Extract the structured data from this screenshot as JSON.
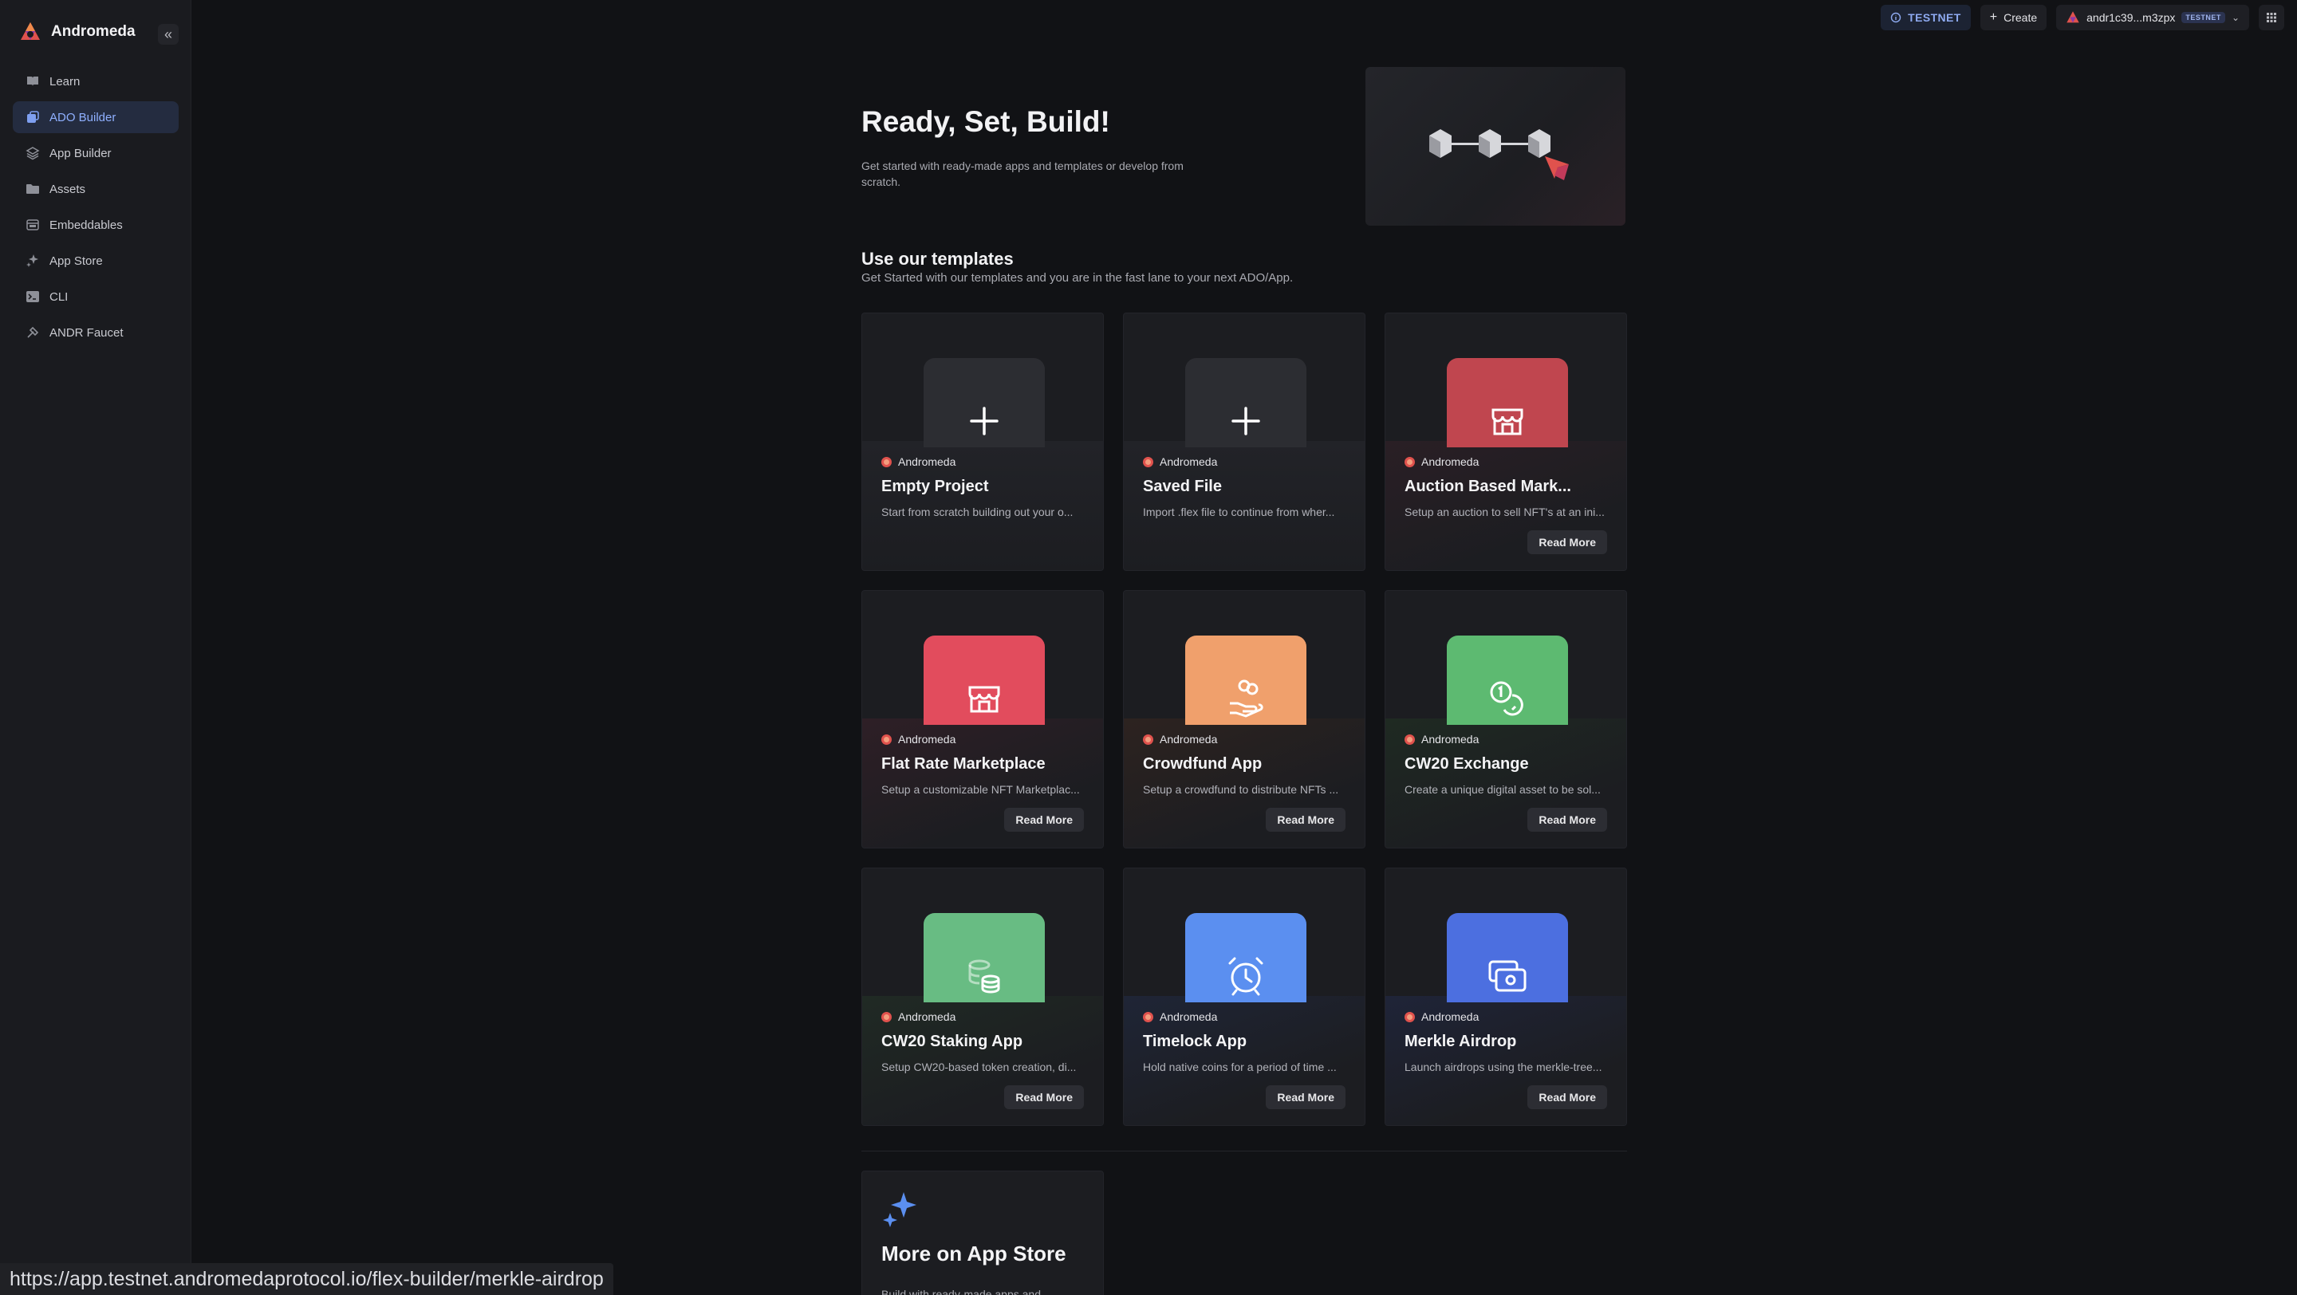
{
  "app": {
    "name": "Andromeda"
  },
  "sidebar": {
    "collapse_icon": "double-chevron-left-icon",
    "items": [
      {
        "label": "Learn",
        "icon": "book-icon",
        "active": false
      },
      {
        "label": "ADO Builder",
        "icon": "builder-icon",
        "active": true
      },
      {
        "label": "App Builder",
        "icon": "layers-icon",
        "active": false
      },
      {
        "label": "Assets",
        "icon": "folder-icon",
        "active": false
      },
      {
        "label": "Embeddables",
        "icon": "embed-icon",
        "active": false
      },
      {
        "label": "App Store",
        "icon": "sparkle-icon",
        "active": false
      },
      {
        "label": "CLI",
        "icon": "terminal-icon",
        "active": false
      },
      {
        "label": "ANDR Faucet",
        "icon": "faucet-icon",
        "active": false
      }
    ]
  },
  "topbar": {
    "network_label": "TESTNET",
    "create_label": "Create",
    "wallet_address": "andr1c39...m3zpx",
    "wallet_badge": "TESTNET"
  },
  "hero": {
    "title": "Ready, Set, Build!",
    "subtitle": "Get started with ready-made apps and templates or develop from scratch."
  },
  "templates": {
    "title": "Use our templates",
    "subtitle": "Get Started with our templates and you are in the fast lane to your next ADO/App.",
    "cards": [
      {
        "maker": "Andromeda",
        "title": "Empty Project",
        "desc": "Start from scratch building out your o...",
        "icon": "plus-icon",
        "color": "#2c2d32",
        "read_more": ""
      },
      {
        "maker": "Andromeda",
        "title": "Saved File",
        "desc": "Import .flex file to continue from wher...",
        "icon": "plus-icon",
        "color": "#2c2d32",
        "read_more": ""
      },
      {
        "maker": "Andromeda",
        "title": "Auction Based Mark...",
        "desc": "Setup an auction to sell NFT's at an ini...",
        "icon": "store-icon",
        "color": "#c0464f",
        "read_more": "Read More"
      },
      {
        "maker": "Andromeda",
        "title": "Flat Rate Marketplace",
        "desc": "Setup a customizable NFT Marketplac...",
        "icon": "store-icon",
        "color": "#e24c5d",
        "read_more": "Read More"
      },
      {
        "maker": "Andromeda",
        "title": "Crowdfund App",
        "desc": "Setup a crowdfund to distribute NFTs ...",
        "icon": "hand-coins-icon",
        "color": "#f0a06c",
        "read_more": "Read More"
      },
      {
        "maker": "Andromeda",
        "title": "CW20 Exchange",
        "desc": "Create a unique digital asset to be sol...",
        "icon": "coins-exchange-icon",
        "color": "#5dba71",
        "read_more": "Read More"
      },
      {
        "maker": "Andromeda",
        "title": "CW20 Staking App",
        "desc": "Setup CW20-based token creation, di...",
        "icon": "coin-stack-icon",
        "color": "#68bc83",
        "read_more": "Read More"
      },
      {
        "maker": "Andromeda",
        "title": "Timelock App",
        "desc": "Hold native coins for a period of time ...",
        "icon": "alarm-clock-icon",
        "color": "#5b8ff0",
        "read_more": "Read More"
      },
      {
        "maker": "Andromeda",
        "title": "Merkle Airdrop",
        "desc": "Launch airdrops using the merkle-tree...",
        "icon": "banknotes-icon",
        "color": "#4c6fe0",
        "read_more": "Read More"
      }
    ]
  },
  "app_store": {
    "title": "More on App Store",
    "desc": "Build with ready-made apps and...",
    "icon": "sparkle-icon"
  },
  "status_url": "https://app.testnet.andromedaprotocol.io/flex-builder/merkle-airdrop"
}
